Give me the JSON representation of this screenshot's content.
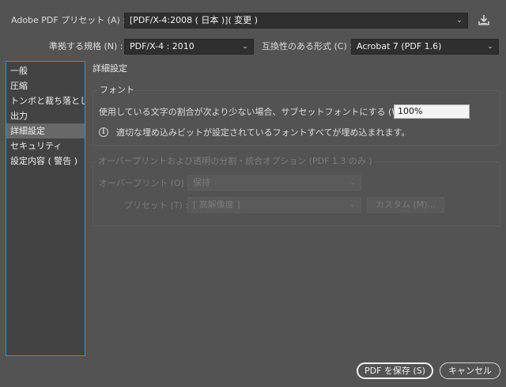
{
  "top": {
    "preset_label": "Adobe PDF プリセット (A) :",
    "preset_value": "[PDF/X-4:2008 ( 日本 )]( 変更 )",
    "standard_label": "準拠する規格 (N) :",
    "standard_value": "PDF/X-4 : 2010",
    "compat_label": "互換性のある形式 (C) :",
    "compat_value": "Acrobat 7 (PDF 1.6)"
  },
  "sidebar": {
    "items": [
      {
        "label": "一般"
      },
      {
        "label": "圧縮"
      },
      {
        "label": "トンボと裁ち落とし"
      },
      {
        "label": "出力"
      },
      {
        "label": "詳細設定"
      },
      {
        "label": "セキュリティ"
      },
      {
        "label": "設定内容 ( 警告 )"
      }
    ],
    "active_index": 4
  },
  "main": {
    "section_title": "詳細設定",
    "font_group": {
      "title": "フォント",
      "subset_label": "使用している文字の割合が次より少ない場合、サブセットフォントにする (W) :",
      "subset_value": "100%",
      "info_text": "適切な埋め込みビットが設定されているフォントすべてが埋め込まれます。"
    },
    "overprint_group": {
      "title": "オーバープリントおよび透明の分割・統合オプション (PDF 1.3 のみ )",
      "overprint_label": "オーバープリント (O) :",
      "overprint_value": "保持",
      "preset_label": "プリセット (T) :",
      "preset_value": "[ 高解像度 ]",
      "custom_button": "カスタム (M)..."
    }
  },
  "footer": {
    "save_button": "PDF を保存 (S)",
    "cancel_button": "キャンセル"
  },
  "icons": {
    "chevron": "chevron-down-icon",
    "save_preset": "save-preset-icon",
    "info": "info-icon"
  }
}
